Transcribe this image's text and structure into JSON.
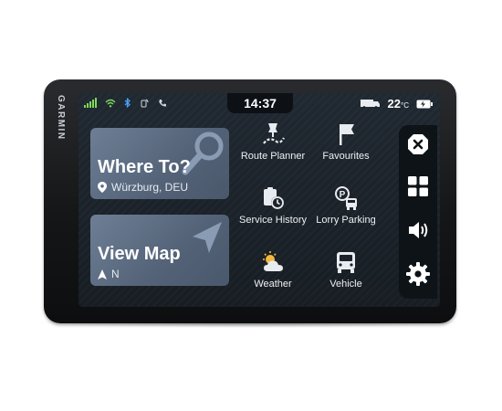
{
  "device": {
    "brand": "GARMIN"
  },
  "status": {
    "time": "14:37",
    "temperature": "22",
    "temp_unit": "°C"
  },
  "cards": {
    "where_to": {
      "title": "Where To?",
      "location": "Würzburg, DEU"
    },
    "view_map": {
      "title": "View Map",
      "heading": "N"
    }
  },
  "apps": [
    {
      "label": "Route Planner",
      "icon": "route-planner-icon"
    },
    {
      "label": "Favourites",
      "icon": "favourites-flag-icon"
    },
    {
      "label": "Service History",
      "icon": "service-history-icon"
    },
    {
      "label": "Lorry Parking",
      "icon": "lorry-parking-icon"
    },
    {
      "label": "Weather",
      "icon": "weather-icon"
    },
    {
      "label": "Vehicle",
      "icon": "vehicle-icon"
    }
  ],
  "sidebar": [
    {
      "icon": "close-icon"
    },
    {
      "icon": "apps-grid-icon"
    },
    {
      "icon": "volume-icon"
    },
    {
      "icon": "settings-gear-icon"
    }
  ],
  "colors": {
    "signal": "#7ed957",
    "card": "#5f6f84",
    "screen": "#1c2229"
  }
}
